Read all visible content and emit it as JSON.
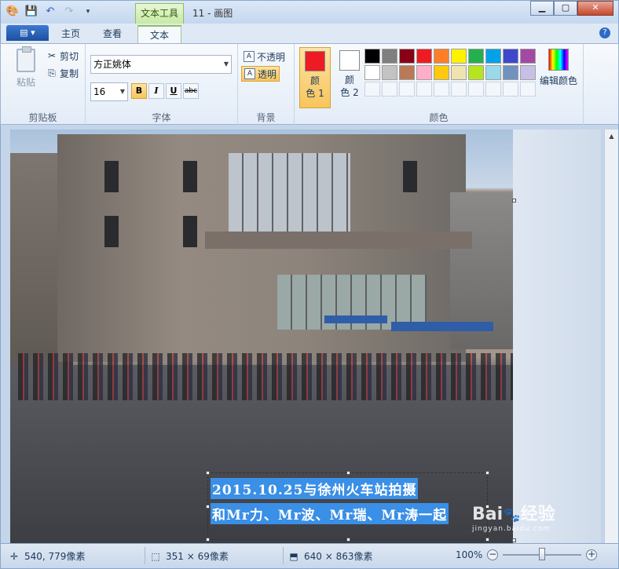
{
  "window": {
    "context_tab_label": "文本工具",
    "title": "11 - 画图"
  },
  "tabs": {
    "home": "主页",
    "view": "查看",
    "text": "文本"
  },
  "clipboard": {
    "paste": "粘贴",
    "cut": "剪切",
    "copy": "复制",
    "label": "剪贴板"
  },
  "font": {
    "family": "方正姚体",
    "size": "16",
    "bold": "B",
    "italic": "I",
    "underline": "U",
    "strikethrough": "abc",
    "label": "字体"
  },
  "background": {
    "opaque": "不透明",
    "transparent": "透明",
    "label": "背景"
  },
  "colors": {
    "color1_label_a": "颜",
    "color1_label_b": "色 1",
    "color2_label_a": "颜",
    "color2_label_b": "色 2",
    "edit_colors": "编辑颜色",
    "label": "颜色",
    "color1": "#ed1c24",
    "color2": "#ffffff",
    "palette": [
      "#000000",
      "#7f7f7f",
      "#880015",
      "#ed1c24",
      "#ff7f27",
      "#fff200",
      "#22b14c",
      "#00a2e8",
      "#3f48cc",
      "#a349a4",
      "#ffffff",
      "#c3c3c3",
      "#b97a57",
      "#ffaec9",
      "#ffc90e",
      "#efe4b0",
      "#b5e61d",
      "#99d9ea",
      "#7092be",
      "#c8bfe7"
    ]
  },
  "canvas_text": {
    "line1": "2015.10.25与徐州火车站拍摄",
    "line2": "和Mr力、Mr波、Mr瑞、Mr涛一起"
  },
  "watermark": {
    "brand": "Bai",
    "brand2": "经验",
    "url": "jingyan.baidu.com"
  },
  "status": {
    "cursor_pos": "540, 779像素",
    "selection_size": "351 × 69像素",
    "image_size": "640 × 863像素",
    "zoom": "100%"
  }
}
